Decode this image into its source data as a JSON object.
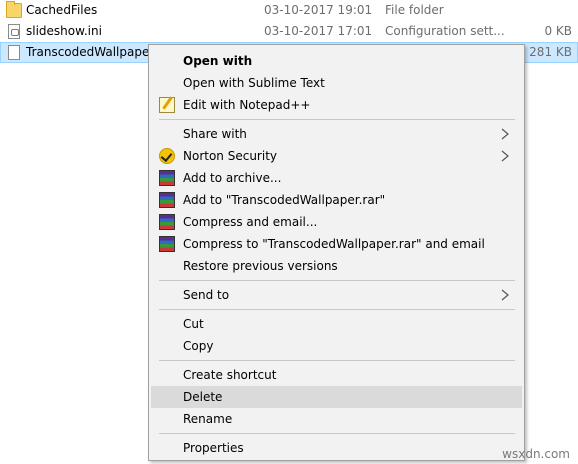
{
  "files": [
    {
      "name": "CachedFiles",
      "date": "03-10-2017 19:01",
      "type": "File folder",
      "size": "",
      "icon": "folder-icon"
    },
    {
      "name": "slideshow.ini",
      "date": "03-10-2017 17:01",
      "type": "Configuration sett...",
      "size": "0 KB",
      "icon": "ini-file-icon"
    },
    {
      "name": "TranscodedWallpaper",
      "date": "",
      "type": "",
      "size": "281 KB",
      "icon": "file-icon",
      "selected": true
    }
  ],
  "menu": {
    "open_with_bold": "Open with",
    "open_with_sublime": "Open with Sublime Text",
    "edit_notepad": "Edit with Notepad++",
    "share_with": "Share with",
    "norton_security": "Norton Security",
    "add_to_archive": "Add to archive...",
    "add_to_rar": "Add to \"TranscodedWallpaper.rar\"",
    "compress_email": "Compress and email...",
    "compress_rar_email": "Compress to \"TranscodedWallpaper.rar\" and email",
    "restore_previous": "Restore previous versions",
    "send_to": "Send to",
    "cut": "Cut",
    "copy": "Copy",
    "create_shortcut": "Create shortcut",
    "delete": "Delete",
    "rename": "Rename",
    "properties": "Properties"
  },
  "watermark": "wsxdn.com",
  "colors": {
    "selection": "#cce8ff",
    "menu_bg": "#f2f2f2",
    "hover": "#dadada"
  }
}
